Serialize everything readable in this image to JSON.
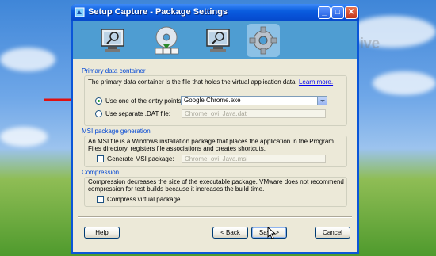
{
  "desktop": {
    "watermark": "etenetlive"
  },
  "window": {
    "title": "Setup Capture - Package Settings",
    "controls": {
      "minimize": "_",
      "maximize": "□",
      "close": "✕"
    }
  },
  "steps": [
    {
      "name": "capture-monitor"
    },
    {
      "name": "install-disc"
    },
    {
      "name": "analyze-monitor"
    },
    {
      "name": "package-settings-gear"
    }
  ],
  "primary": {
    "header": "Primary data container",
    "description": "The primary data container is the file that holds the virtual application data.",
    "learn_more": "Learn more.",
    "entry_points_label": "Use one of the entry points:",
    "entry_points_value": "Google Chrome.exe",
    "separate_dat_label": "Use separate .DAT file:",
    "separate_dat_value": "Chrome_ovi_Java.dat"
  },
  "msi": {
    "header": "MSI package generation",
    "description_line1": "An MSI file is a Windows installation package that places the application in the Program",
    "description_line2": "Files directory, registers file associations and creates shortcuts.",
    "generate_label": "Generate MSI package:",
    "generate_value": "Chrome_ovi_Java.msi"
  },
  "compression": {
    "header": "Compression",
    "description_line1": "Compression decreases the size of the executable package. VMware does not recommend",
    "description_line2": "compression for test builds because it increases the build time.",
    "compress_label": "Compress virtual package"
  },
  "buttons": {
    "help": "Help",
    "back": "< Back",
    "save": "Save >",
    "cancel": "Cancel"
  }
}
